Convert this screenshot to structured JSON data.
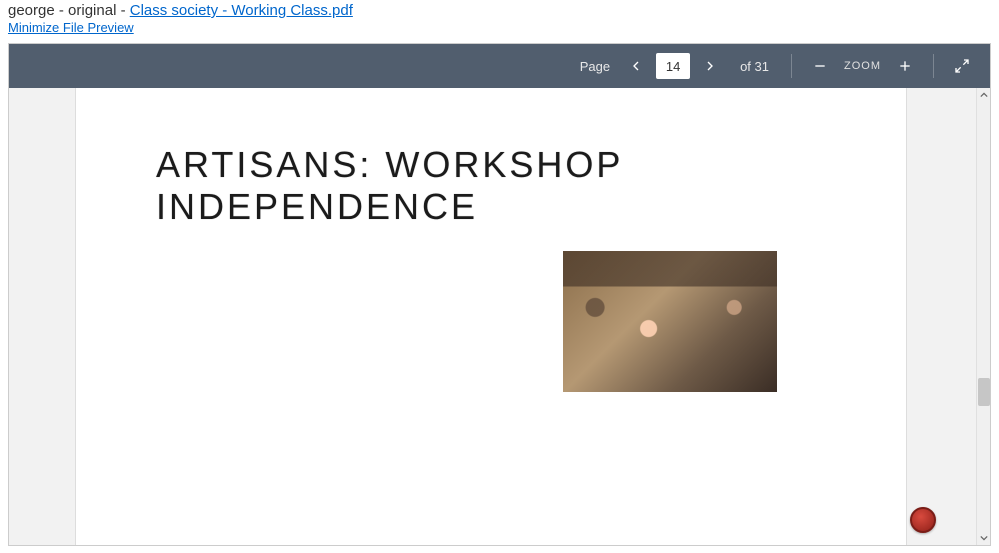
{
  "header": {
    "prefix": "george - original - ",
    "filename": "Class society - Working Class.pdf",
    "minimize": "Minimize File Preview"
  },
  "toolbar": {
    "page_label": "Page",
    "current_page": "14",
    "total_pages": "of 31",
    "zoom_label": "ZOOM"
  },
  "slide": {
    "title": "ARTISANS: WORKSHOP INDEPENDENCE"
  },
  "icons": {
    "prev": "prev-page-icon",
    "next": "next-page-icon",
    "minus": "zoom-out-icon",
    "plus": "zoom-in-icon",
    "fullscreen": "fullscreen-icon",
    "scroll_up": "scroll-up-icon",
    "scroll_down": "scroll-down-icon"
  }
}
